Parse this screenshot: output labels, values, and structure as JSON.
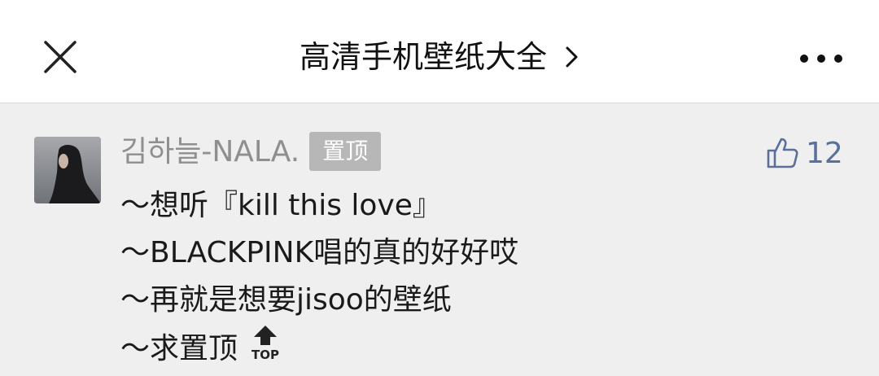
{
  "header": {
    "title": "高清手机壁纸大全",
    "close_icon": "close-icon",
    "chevron_icon": "chevron-right-icon",
    "more_icon": "more-horizontal-icon"
  },
  "comment": {
    "author": "김하늘-NALA.",
    "badge": "置顶",
    "likes": "12",
    "like_icon": "thumbs-up-icon",
    "lines": [
      "～想听『kill this love』",
      "～BLACKPINK唱的真的好好哎",
      "～再就是想要jisoo的壁纸",
      "～求置顶"
    ],
    "top_icon_label": "TOP"
  },
  "colors": {
    "background": "#efefef",
    "header_bg": "#ffffff",
    "author": "#8f8f8f",
    "badge_bg": "#b7b7b7",
    "like": "#5a6f9a"
  }
}
